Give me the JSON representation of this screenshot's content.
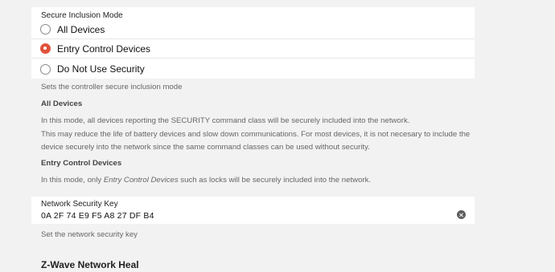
{
  "inclusion": {
    "label": "Secure Inclusion Mode",
    "options": [
      {
        "label": "All Devices",
        "selected": false
      },
      {
        "label": "Entry Control Devices",
        "selected": true
      },
      {
        "label": "Do Not Use Security",
        "selected": false
      }
    ],
    "help": "Sets the controller secure inclusion mode"
  },
  "descriptions": {
    "all_title": "All Devices",
    "all_line1": "In this mode, all devices reporting the SECURITY command class will be securely included into the network.",
    "all_line2": "This may reduce the life of battery devices and slow down communications. For most devices, it is not necesary to include the",
    "all_line3": "device securely into the network since the same command classes can be used without security.",
    "entry_title": "Entry Control Devices",
    "entry_line_prefix": "In this mode, only ",
    "entry_line_em": "Entry Control Devices",
    "entry_line_suffix": " such as locks will be securely included into the network."
  },
  "security_key": {
    "label": "Network Security Key",
    "value": "0A 2F 74 E9 F5 A8 27 DF B4",
    "help": "Set the network security key"
  },
  "next_section": {
    "title": "Z-Wave Network Heal"
  },
  "colors": {
    "accent": "#e0533a",
    "background": "#f2f2f2",
    "card": "#ffffff"
  },
  "icons": {
    "clear": "close-circle-icon"
  }
}
